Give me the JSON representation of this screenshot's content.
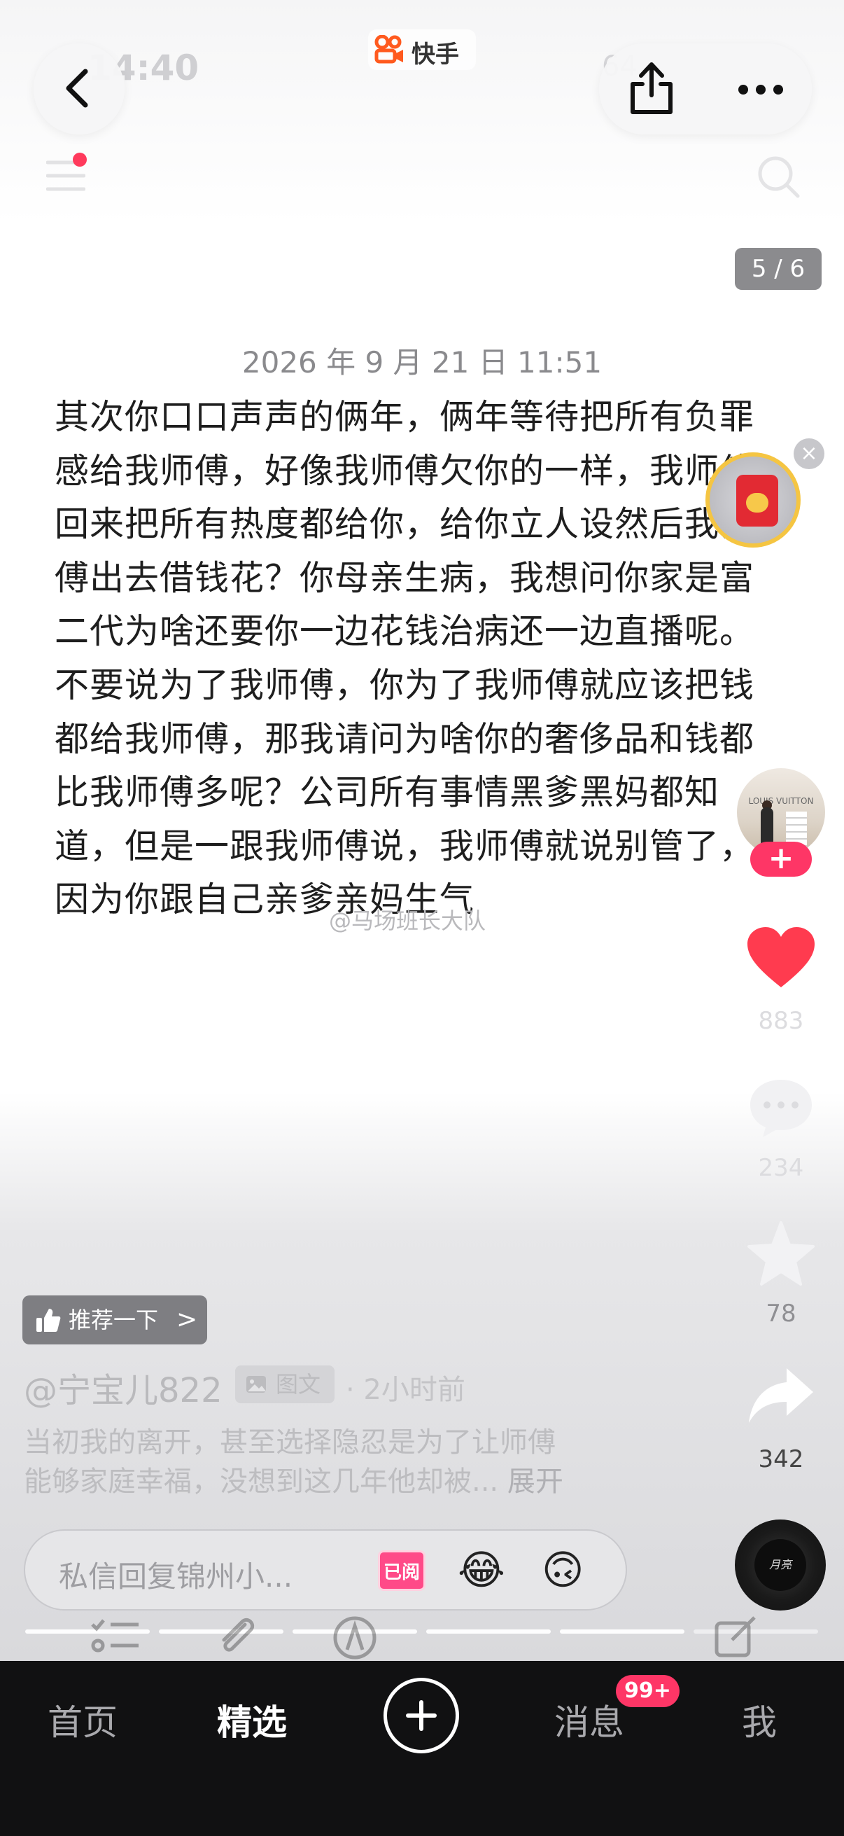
{
  "status_bar": {
    "time": "14:40",
    "battery": "64"
  },
  "header": {
    "app_logo_text": "快手",
    "page_counter": "5 / 6"
  },
  "post": {
    "date": "2026 年 9 月 21 日 11:51",
    "body_lines": [
      "其次你口口声声的俩年，俩年等待把所有负罪",
      "感给我师傅，好像我师傅欠你的一样，我师傅",
      "回来把所有热度都给你，给你立人设然后我师",
      "傅出去借钱花？你母亲生病，我想问你家是富",
      "二代为啥还要你一边花钱治病还一边直播呢。",
      "不要说为了我师傅，你为了我师傅就应该把钱",
      "都给我师傅，那我请问为啥你的奢侈品和钱都",
      "比我师傅多呢？公司所有事情黑爹黑妈都知",
      "道，但是一跟我师傅说，我师傅就说别管了，",
      "因为你跟自己亲爹亲妈生气"
    ],
    "watermark": "@马场班长大队"
  },
  "sidebar": {
    "avatar_brand": "LOUIS VUITTON",
    "follow_label": "+",
    "like_count": "883",
    "comment_count": "234",
    "favorite_count": "78",
    "share_count": "342"
  },
  "recommend": {
    "label": "推荐一下",
    "chevron": ">"
  },
  "author": {
    "handle": "@宁宝儿822",
    "type_label": "图文",
    "time_ago": "· 2小时前",
    "caption_line1": "当初我的离开，甚至选择隐忍是为了让师傅",
    "caption_line2": "能够家庭幸福，没想到这几年他却被...",
    "expand_label": "展开"
  },
  "comment_bar": {
    "placeholder": "私信回复锦州小...",
    "read_badge": "已阅",
    "emoji1": "😂",
    "emoji2": "🙃"
  },
  "music": {
    "disc_label": "月亮"
  },
  "bottom_nav": {
    "home": "首页",
    "featured": "精选",
    "messages": "消息",
    "messages_badge": "99+",
    "me": "我"
  },
  "colors": {
    "accent_pink": "#fe3666",
    "heart_red": "#ff3b4f",
    "nav_bg": "#111112"
  },
  "icons": [
    "back-arrow-icon",
    "share-icon",
    "more-icon",
    "menu-icon",
    "search-icon",
    "heart-icon",
    "comment-icon",
    "star-icon",
    "share-arrow-icon",
    "thumbs-up-icon",
    "image-icon",
    "plus-icon"
  ]
}
